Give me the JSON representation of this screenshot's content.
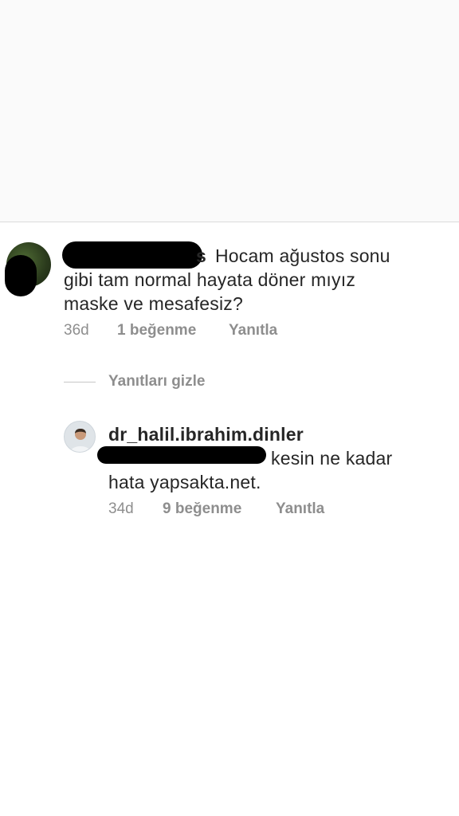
{
  "comment": {
    "username_visible_suffix": "s",
    "text_line1": "Hocam ağustos sonu",
    "text_line2": "gibi tam normal hayata döner mıyız",
    "text_line3": "maske ve mesafesiz?",
    "time": "36d",
    "likes": "1 beğenme",
    "reply": "Yanıtla"
  },
  "hide_replies": "Yanıtları gizle",
  "reply_comment": {
    "username": "dr_halil.ibrahim.dinler",
    "text_line1": "kesin ne kadar",
    "text_line2": "hata yapsakta.net.",
    "time": "34d",
    "likes": "9 beğenme",
    "reply": "Yanıtla"
  }
}
